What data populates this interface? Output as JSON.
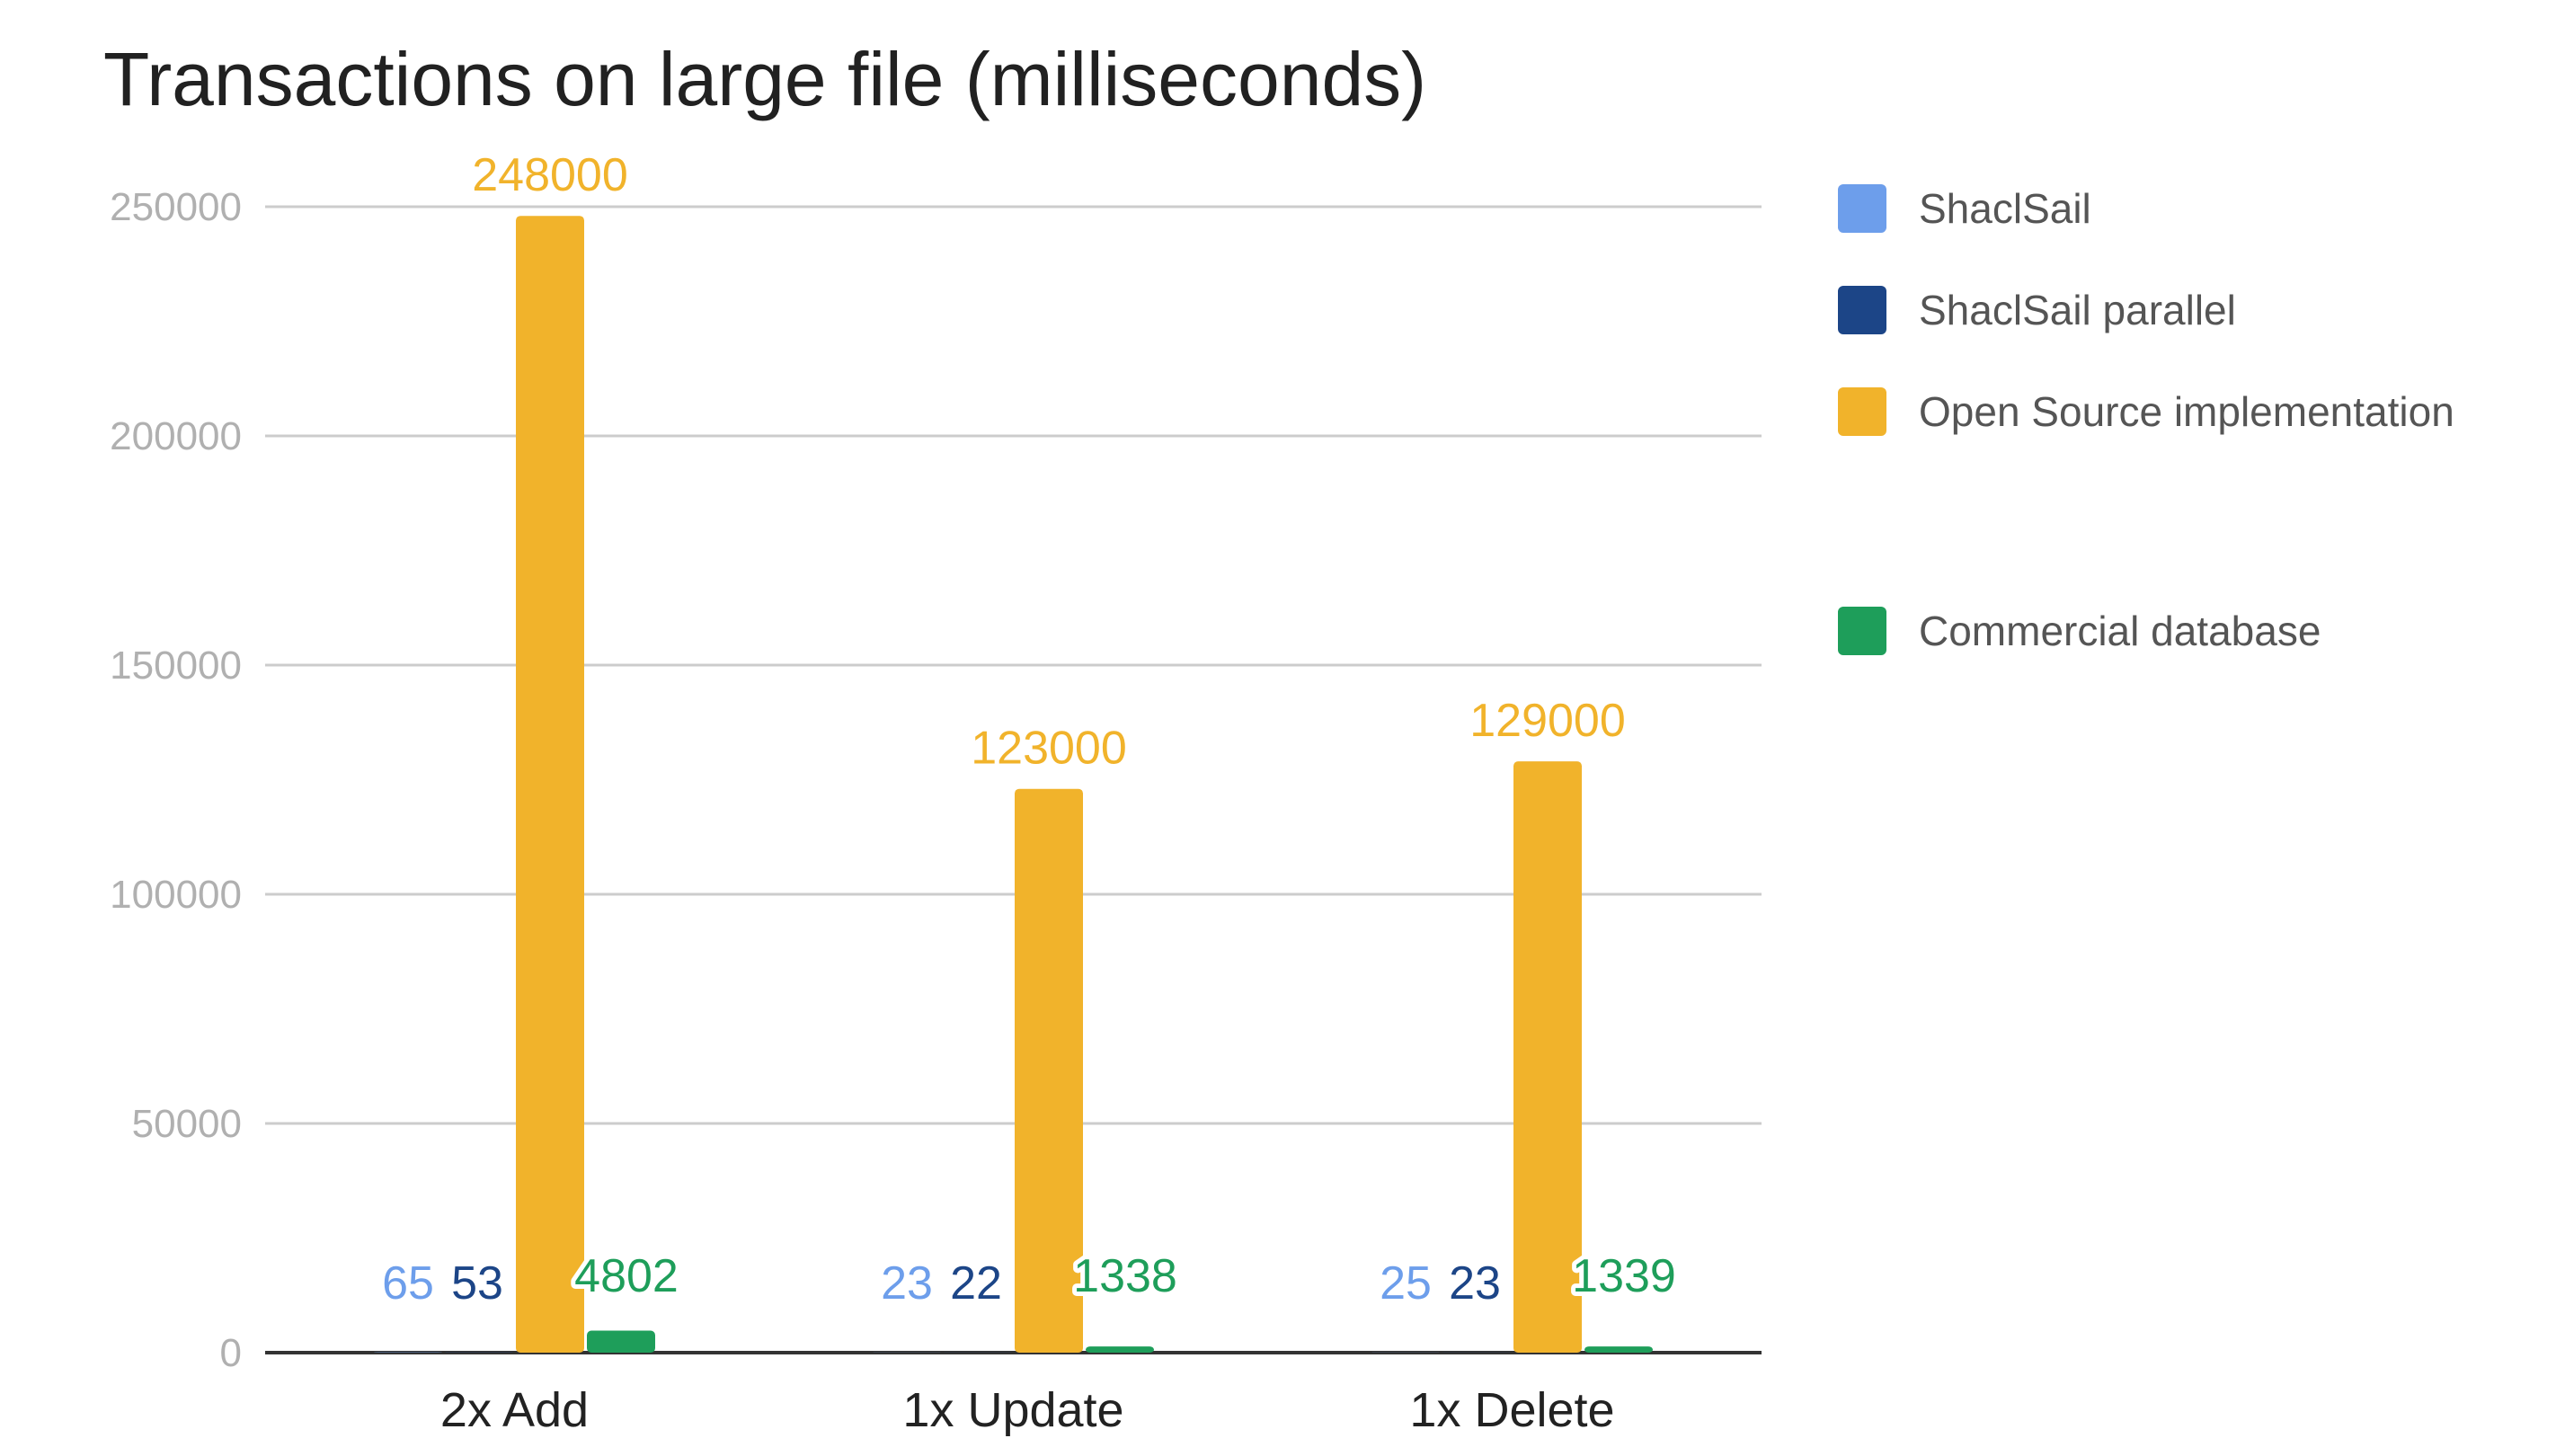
{
  "chart_data": {
    "type": "bar",
    "title": "Transactions on large file (milliseconds)",
    "xlabel": "",
    "ylabel": "",
    "categories": [
      "2x Add",
      "1x Update",
      "1x Delete"
    ],
    "ylim": [
      0,
      250000
    ],
    "yticks": [
      "0",
      "50000",
      "100000",
      "150000",
      "200000",
      "250000"
    ],
    "grid": true,
    "legend_position": "right",
    "series": [
      {
        "name": "ShaclSail",
        "color": "#6d9eeb",
        "values": [
          65,
          23,
          25
        ],
        "labels": [
          "65",
          "23",
          "25"
        ]
      },
      {
        "name": "ShaclSail parallel",
        "color": "#1c4587",
        "values": [
          53,
          22,
          23
        ],
        "labels": [
          "53",
          "22",
          "23"
        ]
      },
      {
        "name": "Open Source implementation",
        "color": "#f1b32b",
        "values": [
          248000,
          123000,
          129000
        ],
        "labels": [
          "248000",
          "123000",
          "129000"
        ]
      },
      {
        "name": "Commercial database",
        "color": "#1e9e5a",
        "values": [
          4802,
          1338,
          1339
        ],
        "labels": [
          "4802",
          "1338",
          "1339"
        ]
      }
    ]
  }
}
